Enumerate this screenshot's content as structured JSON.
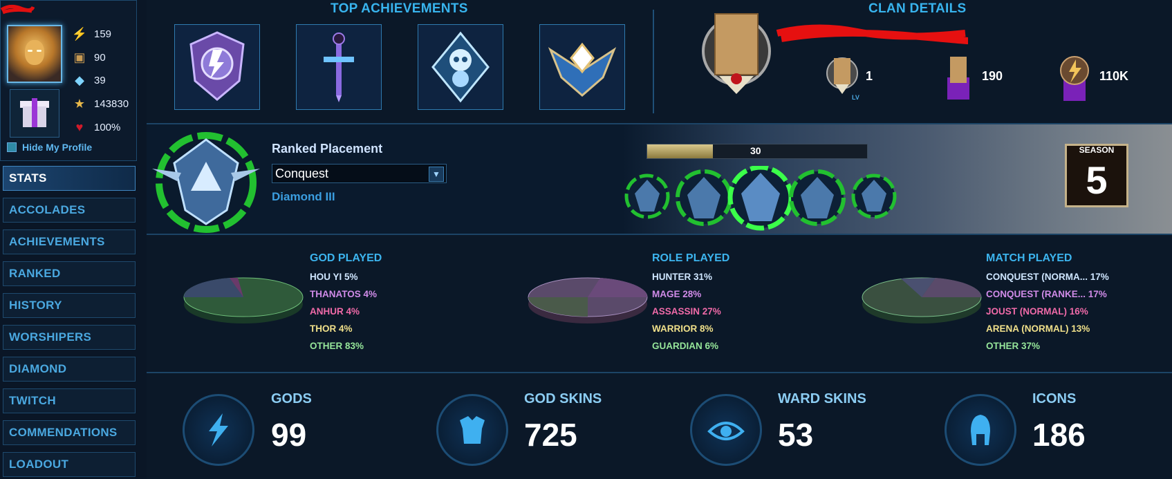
{
  "profile": {
    "stats": [
      {
        "icon": "level-bolt-icon",
        "value": "159"
      },
      {
        "icon": "chest-icon",
        "value": "90"
      },
      {
        "icon": "gem-icon",
        "value": "39"
      },
      {
        "icon": "star-icon",
        "value": "143830"
      },
      {
        "icon": "heart-icon",
        "value": "100%"
      }
    ],
    "hide_profile_label": "Hide My Profile"
  },
  "nav": {
    "items": [
      "STATS",
      "ACCOLADES",
      "ACHIEVEMENTS",
      "RANKED",
      "HISTORY",
      "WORSHIPERS",
      "DIAMOND",
      "TWITCH",
      "COMMENDATIONS",
      "LOADOUT"
    ],
    "active": "STATS"
  },
  "achievements": {
    "title": "TOP ACHIEVEMENTS",
    "items": [
      "purple-shield-badge-icon",
      "sword-badge-icon",
      "crystal-skull-badge-icon",
      "winged-diamond-badge-icon"
    ]
  },
  "clan": {
    "title": "CLAN DETAILS",
    "level": "1",
    "level_tag": "LV",
    "members": "190",
    "power": "110K"
  },
  "ranked": {
    "label": "Ranked Placement",
    "mode": "Conquest",
    "tier": "Diamond III",
    "progress_value": 30,
    "progress_label": "30",
    "season_label": "SEASON",
    "season_number": "5"
  },
  "pies": {
    "god": {
      "title": "GOD PLAYED",
      "entries": [
        {
          "label": "HOU YI 5%",
          "color": "#cfe6ff"
        },
        {
          "label": "THANATOS 4%",
          "color": "#d08be8"
        },
        {
          "label": "ANHUR 4%",
          "color": "#f06aa8"
        },
        {
          "label": "THOR 4%",
          "color": "#f0e08a"
        },
        {
          "label": "OTHER 83%",
          "color": "#96e69a"
        }
      ]
    },
    "role": {
      "title": "ROLE PLAYED",
      "entries": [
        {
          "label": "HUNTER 31%",
          "color": "#cfe6ff"
        },
        {
          "label": "MAGE 28%",
          "color": "#d08be8"
        },
        {
          "label": "ASSASSIN 27%",
          "color": "#f06aa8"
        },
        {
          "label": "WARRIOR 8%",
          "color": "#f0e08a"
        },
        {
          "label": "GUARDIAN 6%",
          "color": "#96e69a"
        }
      ]
    },
    "match": {
      "title": "MATCH PLAYED",
      "entries": [
        {
          "label": "CONQUEST (NORMA... 17%",
          "color": "#cfe6ff"
        },
        {
          "label": "CONQUEST (RANKE... 17%",
          "color": "#d08be8"
        },
        {
          "label": "JOUST (NORMAL) 16%",
          "color": "#f06aa8"
        },
        {
          "label": "ARENA (NORMAL) 13%",
          "color": "#f0e08a"
        },
        {
          "label": "OTHER 37%",
          "color": "#96e69a"
        }
      ]
    }
  },
  "counters": [
    {
      "label": "GODS",
      "value": "99",
      "icon": "lightning-icon"
    },
    {
      "label": "GOD SKINS",
      "value": "725",
      "icon": "armor-icon"
    },
    {
      "label": "WARD SKINS",
      "value": "53",
      "icon": "eye-ward-icon"
    },
    {
      "label": "ICONS",
      "value": "186",
      "icon": "helmet-icon"
    }
  ]
}
